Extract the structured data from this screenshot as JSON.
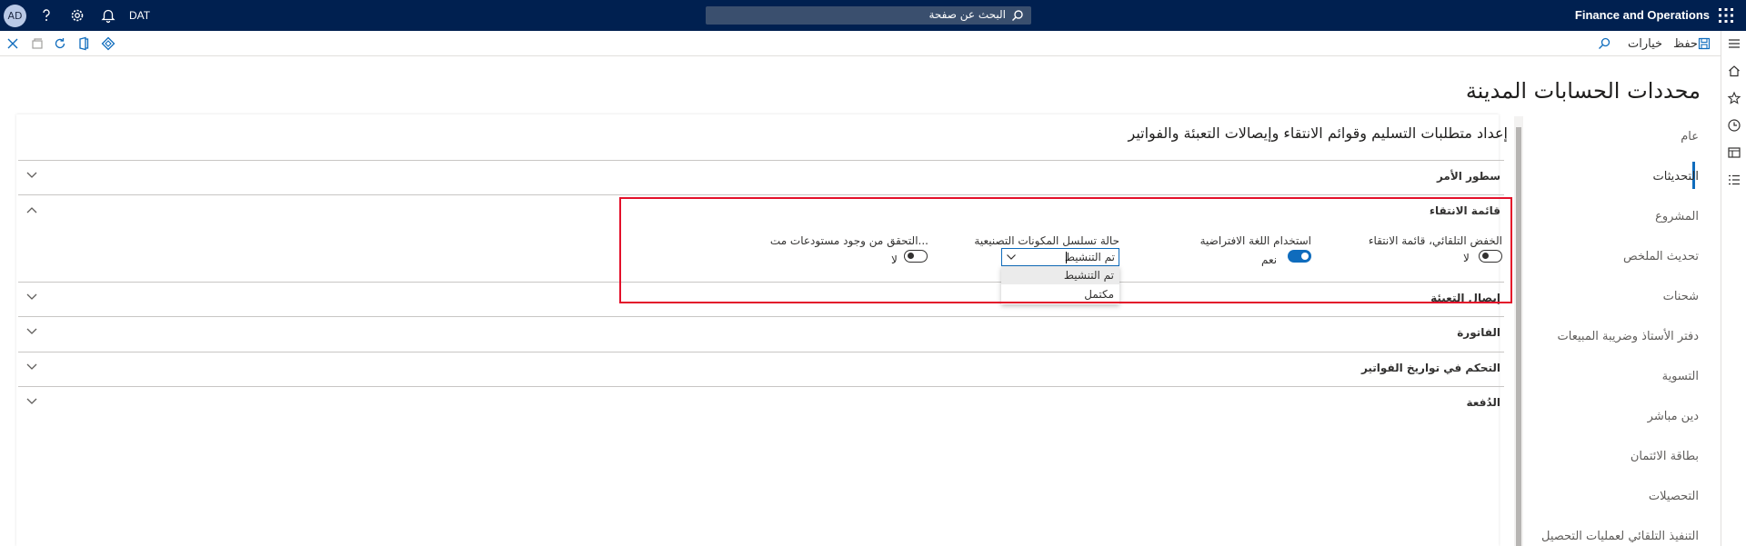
{
  "topbar": {
    "app_title": "Finance and Operations",
    "search_placeholder": "البحث عن صفحة",
    "company": "DAT",
    "avatar_initials": "AD"
  },
  "actionbar": {
    "save_label": "حفظ",
    "options_label": "خيارات"
  },
  "page": {
    "title": "محددات الحسابات المدينة",
    "section_title": "إعداد متطلبات التسليم وقوائم الانتقاء وإيصالات التعبئة والفواتير"
  },
  "tabs": [
    {
      "label": "عام"
    },
    {
      "label": "التحديثات"
    },
    {
      "label": "المشروع"
    },
    {
      "label": "تحديث الملخص"
    },
    {
      "label": "شحنات"
    },
    {
      "label": "دفتر الأستاذ وضريبة المبيعات"
    },
    {
      "label": "التسوية"
    },
    {
      "label": "دين مباشر"
    },
    {
      "label": "بطاقة الائتمان"
    },
    {
      "label": "التحصيلات"
    },
    {
      "label": "التنفيذ التلقائي لعمليات التحصيل"
    }
  ],
  "fasttabs": {
    "order_lines": "سطور الأمر",
    "picking_list": "قائمة الانتقاء",
    "packing_slip": "إيصال التعبئة",
    "invoice": "الفاتورة",
    "invoice_dates": "التحكم في تواريخ الفواتير",
    "payment": "الدُفعة"
  },
  "picking_fields": {
    "auto_reduce_label": "الخفض التلقائي، قائمة الانتقاء",
    "auto_reduce_value": "لا",
    "default_language_label": "استخدام اللغة الافتراضية",
    "default_language_value": "نعم",
    "bom_status_label": "حالة تسلسل المكونات التصنيعية",
    "bom_status_value": "تم التنشيط",
    "warehouse_check_label": "التحقق من وجود مستودعات مت...",
    "warehouse_check_value": "لا"
  },
  "dropdown_options": [
    "تم التنشيط",
    "مكتمل"
  ],
  "colors": {
    "topbar": "#002050",
    "accent": "#0f6cbd",
    "highlight": "#e3102a"
  }
}
